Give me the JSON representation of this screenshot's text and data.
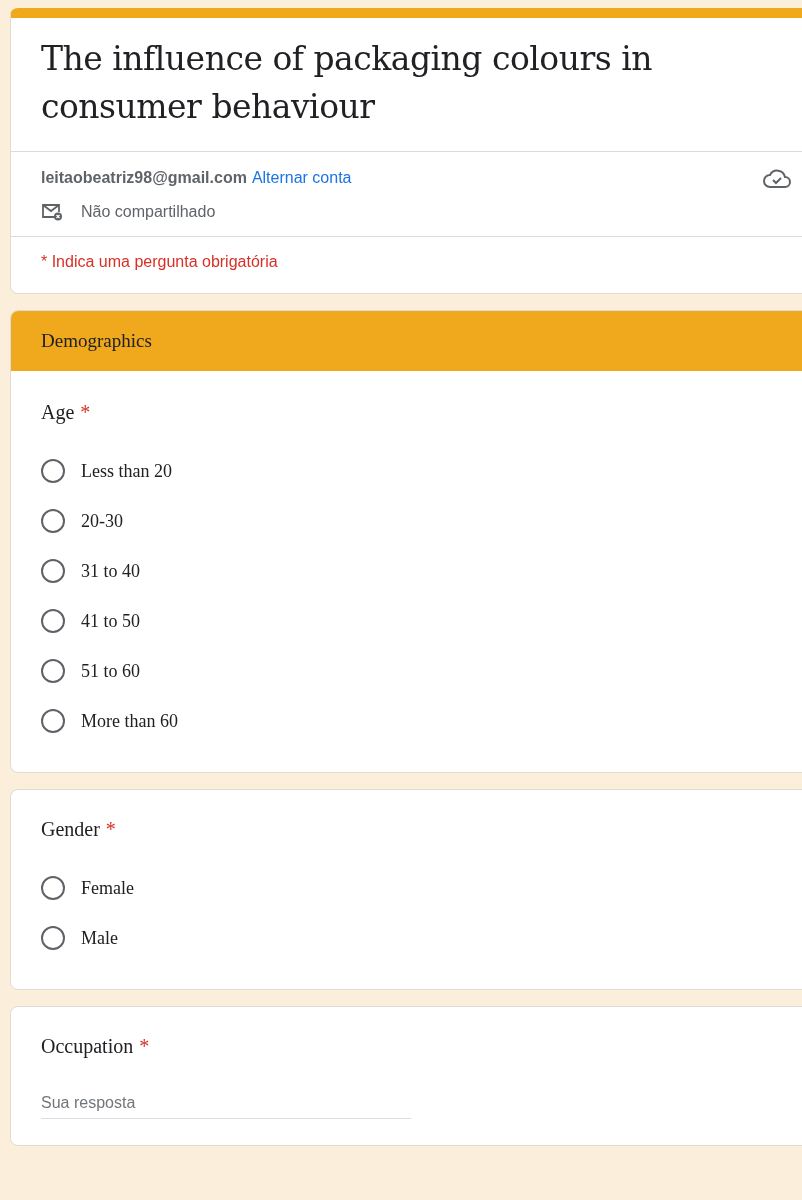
{
  "form": {
    "title": "The influence of packaging colours in consumer behaviour",
    "email": "leitaobeatriz98@gmail.com",
    "switch_account": "Alternar conta",
    "sharing": "Não compartilhado",
    "required_note": "* Indica uma pergunta obrigatória"
  },
  "section": {
    "title": "Demographics"
  },
  "questions": [
    {
      "kind": "radio",
      "title": "Age",
      "required_mark": "*",
      "options": [
        {
          "label": "Less than 20",
          "selected": false
        },
        {
          "label": "20-30",
          "selected": false
        },
        {
          "label": "31 to 40",
          "selected": false
        },
        {
          "label": "41 to 50",
          "selected": false
        },
        {
          "label": "51 to 60",
          "selected": false
        },
        {
          "label": "More than 60",
          "selected": false
        }
      ]
    },
    {
      "kind": "radio",
      "title": "Gender",
      "required_mark": "*",
      "options": [
        {
          "label": "Female",
          "selected": false
        },
        {
          "label": "Male",
          "selected": false
        }
      ]
    },
    {
      "kind": "text",
      "title": "Occupation",
      "required_mark": "*",
      "placeholder": "Sua resposta"
    }
  ]
}
